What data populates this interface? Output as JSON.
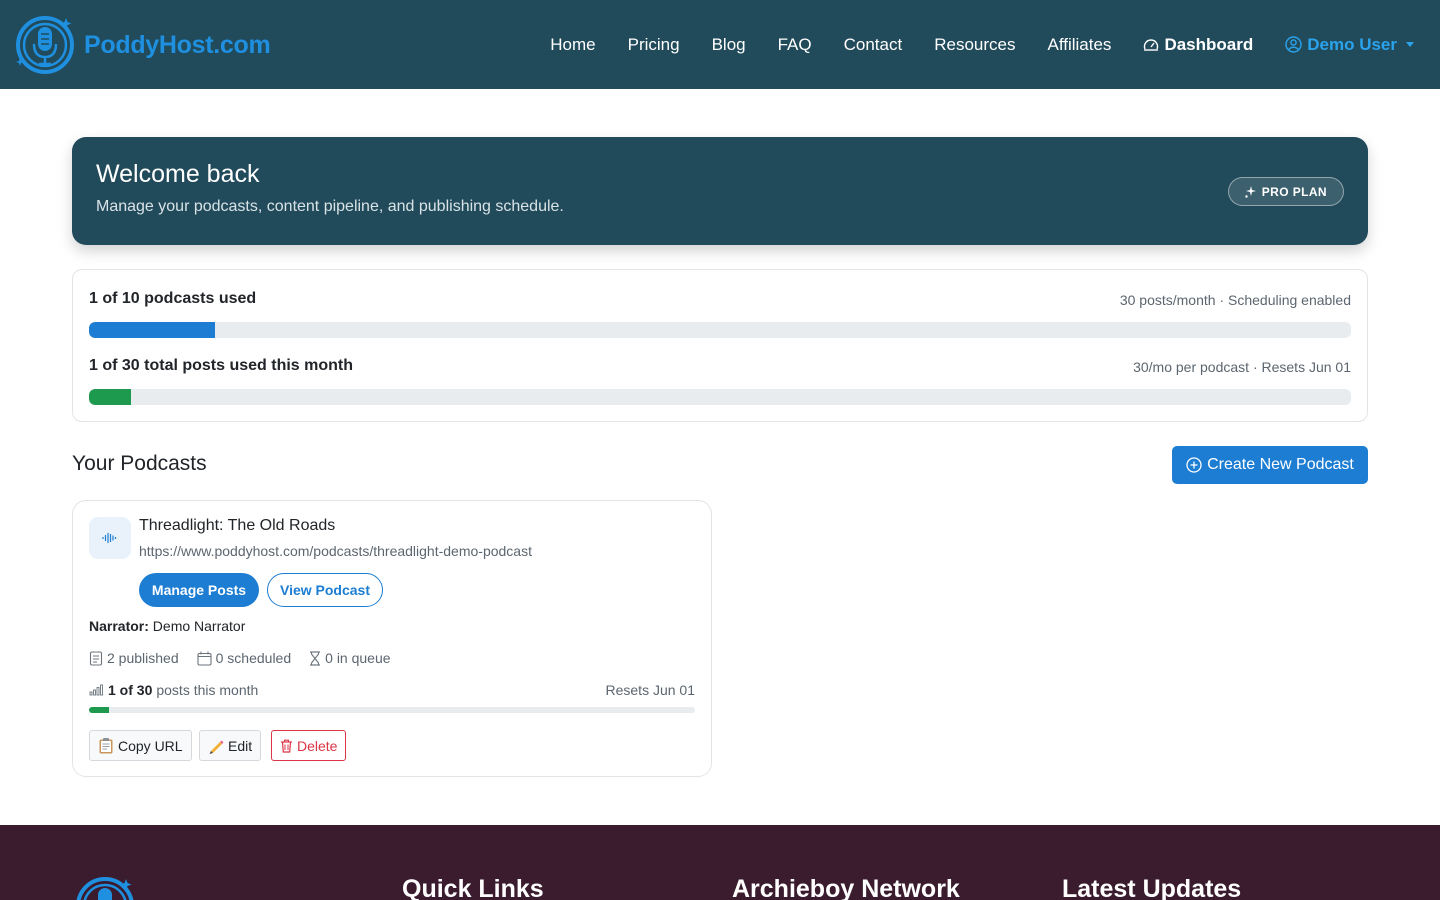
{
  "brand": {
    "name": "PoddyHost.com",
    "icon": "microphone-logo-icon"
  },
  "nav": {
    "links": [
      "Home",
      "Pricing",
      "Blog",
      "FAQ",
      "Contact",
      "Resources",
      "Affiliates"
    ],
    "dashboard": "Dashboard",
    "user": "Demo User"
  },
  "welcome": {
    "title": "Welcome back",
    "subtitle": "Manage your podcasts, content pipeline, and publishing schedule.",
    "plan_badge": "PRO PLAN"
  },
  "usage": {
    "podcasts": {
      "title": "1 of 10 podcasts used",
      "meta": "30 posts/month · Scheduling enabled",
      "fraction": 0.1,
      "color": "#1c7dd2"
    },
    "posts": {
      "title": "1 of 30 total posts used this month",
      "meta": "30/mo per podcast · Resets Jun 01",
      "fraction": 0.0333,
      "color": "#1e9a4e"
    }
  },
  "section": {
    "title": "Your Podcasts",
    "create_button": "Create New Podcast"
  },
  "podcast": {
    "title": "Threadlight: The Old Roads",
    "url": "https://www.poddyhost.com/podcasts/threadlight-demo-podcast",
    "manage_button": "Manage Posts",
    "view_button": "View Podcast",
    "narrator_label": "Narrator:",
    "narrator": "Demo Narrator",
    "published": "2 published",
    "scheduled": "0 scheduled",
    "queue": "0 in queue",
    "month_count": "1 of 30",
    "month_label": "posts this month",
    "resets": "Resets Jun 01",
    "month_fraction": 0.0333,
    "copy_button": "Copy URL",
    "edit_button": "Edit",
    "delete_button": "Delete"
  },
  "footer": {
    "headings": [
      "Quick Links",
      "Archieboy Network",
      "Latest Updates"
    ]
  },
  "colors": {
    "navbar": "#214a5a",
    "accent": "#1c7dd2",
    "success": "#1e9a4e",
    "danger": "#dc3545",
    "footer": "#3a1c2e"
  }
}
